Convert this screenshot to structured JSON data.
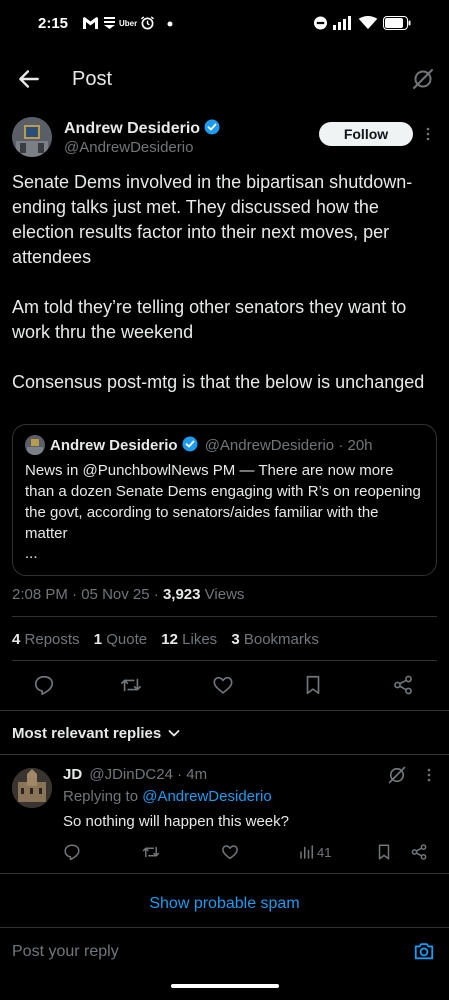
{
  "status_bar": {
    "time": "2:15",
    "icons": [
      "gmail-icon",
      "news-icon",
      "uber-icon",
      "alarm-icon",
      "dot-icon",
      "dnd-icon",
      "signal-icon",
      "wifi-icon",
      "battery-icon"
    ],
    "uber_label": "Uber"
  },
  "header": {
    "title": "Post"
  },
  "post": {
    "author_name": "Andrew Desiderio",
    "author_handle": "@AndrewDesiderio",
    "follow_label": "Follow",
    "paragraphs": [
      "Senate Dems involved in the bipartisan shutdown-ending talks just met. They discussed how the election results factor into their next moves, per attendees",
      "Am told they’re telling other senators they want to work thru the weekend",
      "Consensus post-mtg is that the below is unchanged"
    ],
    "quote": {
      "author_name": "Andrew Desiderio",
      "author_handle": "@AndrewDesiderio",
      "separator": "·",
      "age": "20h",
      "text": "News in @PunchbowlNews PM — There are now more than a dozen Senate Dems engaging with R’s on reopening the govt, according to senators/aides familiar with the matter",
      "ellipsis": "..."
    },
    "time": "2:08 PM",
    "date": "05 Nov 25",
    "dot": "·",
    "views_count": "3,923",
    "views_label": "Views",
    "stats": {
      "reposts_count": "4",
      "reposts_label": "Reposts",
      "quotes_count": "1",
      "quotes_label": "Quote",
      "likes_count": "12",
      "likes_label": "Likes",
      "bookmarks_count": "3",
      "bookmarks_label": "Bookmarks"
    }
  },
  "replies_section": {
    "sort_label": "Most relevant replies"
  },
  "reply": {
    "author_name": "JD",
    "author_handle": "@JDinDC24",
    "separator": "·",
    "age": "4m",
    "replying_prefix": "Replying to",
    "replying_to": "@AndrewDesiderio",
    "text": "So nothing will happen this week?",
    "views": "41"
  },
  "spam_label": "Show probable spam",
  "reply_bar": {
    "placeholder": "Post your reply"
  },
  "colors": {
    "background": "#000000",
    "text": "#e7e9ea",
    "muted": "#71767b",
    "accent": "#1d9bf0",
    "border": "#2f3336"
  }
}
